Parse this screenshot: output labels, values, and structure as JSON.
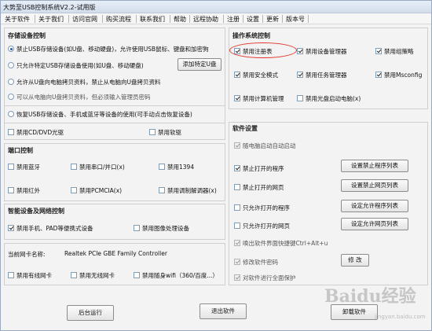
{
  "window": {
    "title": "大势至USB控制系统V2.2-试用版"
  },
  "menu": [
    "关于软件",
    "关于我们",
    "访问官网",
    "购买流程",
    "联系我们",
    "帮助",
    "远程协助",
    "注册",
    "设置",
    "更新",
    "版本号"
  ],
  "storage": {
    "title": "存储设备控制",
    "options": [
      {
        "label": "禁止USB存储设备(如U盘、移动硬盘)，允许使用USB鼠标、键盘和加密狗",
        "checked": true
      },
      {
        "label": "只允许特定USB存储设备使用(如U盘、移动硬盘)",
        "checked": false
      },
      {
        "label": "允许从U盘向电脑拷贝资料，禁止从电脑向U盘拷贝资料",
        "checked": false
      },
      {
        "label": "可以从电脑向U盘拷贝资料，但必须输入管理员密码",
        "checked": false
      },
      {
        "label": "恢复USB存储设备、手机或蓝牙等设备的使用(可手动点击恢复设备)",
        "checked": false
      }
    ],
    "add_button": "添加特定U盘",
    "cd": "禁用CD/DVD光驱",
    "floppy": "禁用软驱"
  },
  "ports": {
    "title": "端口控制",
    "items": [
      "禁用蓝牙",
      "禁用串口/并口(x)",
      "禁用1394",
      "禁用红外",
      "禁用PCMCIA(x)",
      "禁用调制解调器(x)"
    ]
  },
  "smart": {
    "title": "智能设备及网络控制",
    "phone": "禁用手机、PAD等便携式设备",
    "imaging": "禁用图像处理设备"
  },
  "nic": {
    "label": "当前网卡名称:",
    "value": "Realtek PCIe GBE Family Controller",
    "wired": "禁用有线网卡",
    "wireless": "禁用无线网卡",
    "wifi": "禁用随身wifi（360/百度...）"
  },
  "os": {
    "title": "操作系统控制",
    "items": [
      {
        "label": "禁用注册表",
        "checked": true
      },
      {
        "label": "禁用设备管理器",
        "checked": true
      },
      {
        "label": "禁用组策略",
        "checked": true
      },
      {
        "label": "禁用安全模式",
        "checked": true
      },
      {
        "label": "禁用任务管理器",
        "checked": true
      },
      {
        "label": "禁用Msconfig",
        "checked": true
      },
      {
        "label": "禁用计算机管理",
        "checked": true
      },
      {
        "label": "禁用光盘启动电脑(x)",
        "checked": false
      }
    ]
  },
  "software": {
    "title": "软件设置",
    "items": [
      {
        "label": "随电脑启动自动启动",
        "checked": true,
        "disabled": true
      },
      {
        "label": "禁止打开的程序",
        "checked": true,
        "disabled": false
      },
      {
        "label": "禁止打开的网页",
        "checked": false,
        "disabled": false
      },
      {
        "label": "只允许打开的程序",
        "checked": false,
        "disabled": false
      },
      {
        "label": "只允许打开的网页",
        "checked": false,
        "disabled": false
      },
      {
        "label": "唤出软件界面快捷键Ctrl+Alt+u",
        "checked": true,
        "disabled": true
      },
      {
        "label": "修改软件密码",
        "checked": true,
        "disabled": true
      },
      {
        "label": "对软件进行全面保护",
        "checked": true,
        "disabled": true
      }
    ],
    "buttons": [
      "设置禁止程序列表",
      "设置禁止网页列表",
      "设定允许程序列表",
      "设定允许网页列表",
      "修 改"
    ]
  },
  "footer": {
    "background": "后台运行",
    "exit": "退出软件",
    "uninstall": "卸载软件"
  },
  "watermark": {
    "main": "Baidu经验",
    "sub": "jingyan.baidu.com"
  }
}
